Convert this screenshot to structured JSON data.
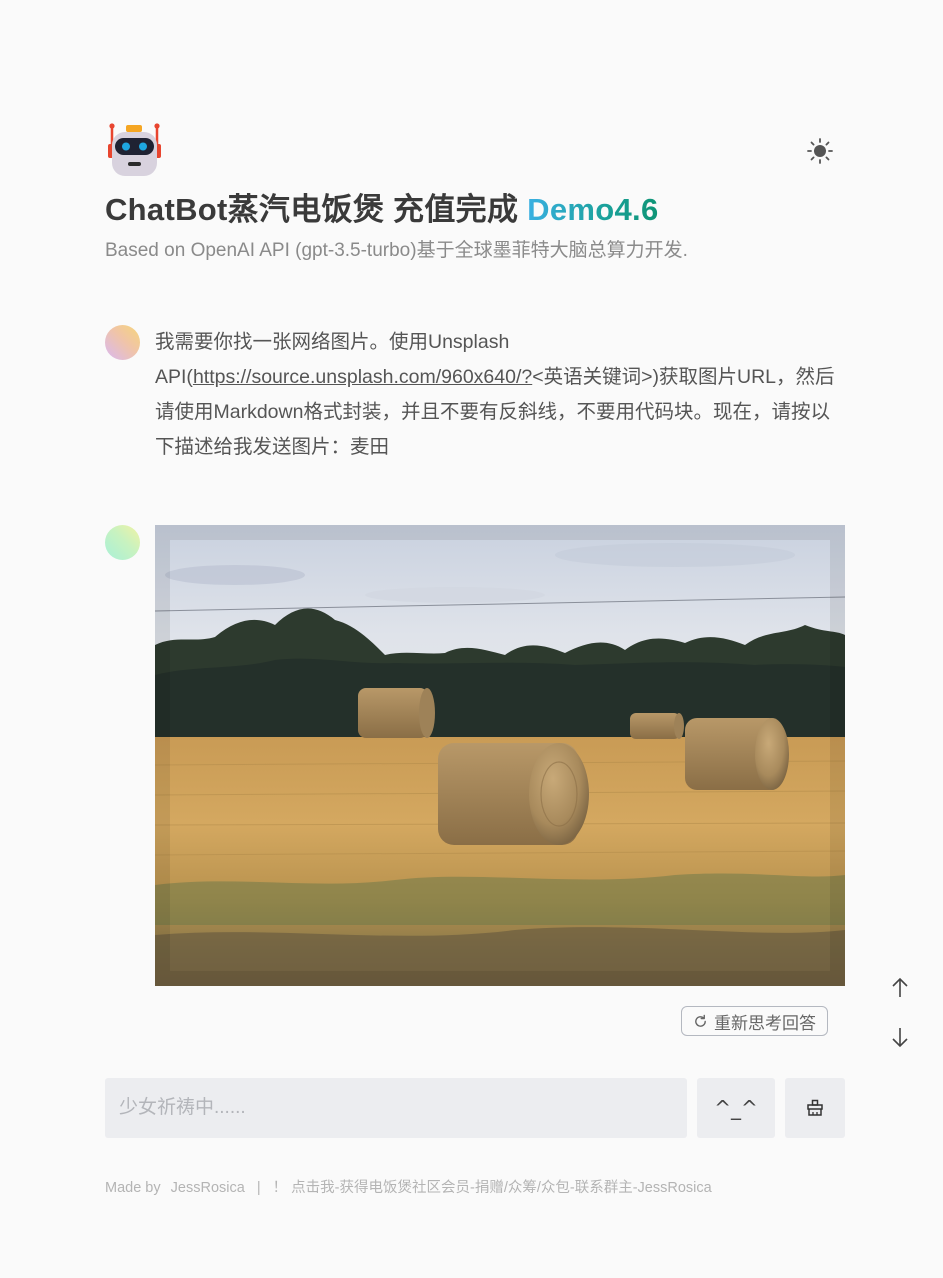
{
  "header": {
    "logo_icon": "robot-icon",
    "theme_toggle_icon": "sun-icon",
    "title_main": "ChatBot蒸汽电饭煲 充值完成 ",
    "title_version": "Demo4.6",
    "subtitle": "Based on OpenAI API (gpt-3.5-turbo)基于全球墨菲特大脑总算力开发."
  },
  "conversation": {
    "user_message": {
      "text_before_link": "我需要你找一张网络图片。使用Unsplash API(",
      "link_text": "https://source.unsplash.com/960x640/?",
      "text_after_link": "<英语关键词>)获取图片URL，然后请使用Markdown格式封装，并且不要有反斜线，不要用代码块。现在，请按以下描述给我发送图片：麦田"
    },
    "bot_message": {
      "image_subject": "hay-bales-in-wheat-field"
    },
    "regenerate_label": "重新思考回答",
    "regenerate_icon": "refresh-icon"
  },
  "scroll": {
    "up_icon": "arrow-up-icon",
    "down_icon": "arrow-down-icon"
  },
  "composer": {
    "placeholder": "少女祈祷中......",
    "value": "",
    "emoji_label": "^_^",
    "clear_icon": "broom-icon"
  },
  "footer": {
    "made_by_label": "Made by",
    "author": "JessRosica",
    "separator": "|",
    "link_text": "！ 点击我-获得电饭煲社区会员-捐赠/众筹/众包-联系群主-JessRosica"
  },
  "colors": {
    "background": "#fafafa",
    "title": "#3a3a3a",
    "version_gradient_start": "#3ab0e2",
    "version_gradient_end": "#0e9475",
    "input_bg": "#ecedf0"
  }
}
